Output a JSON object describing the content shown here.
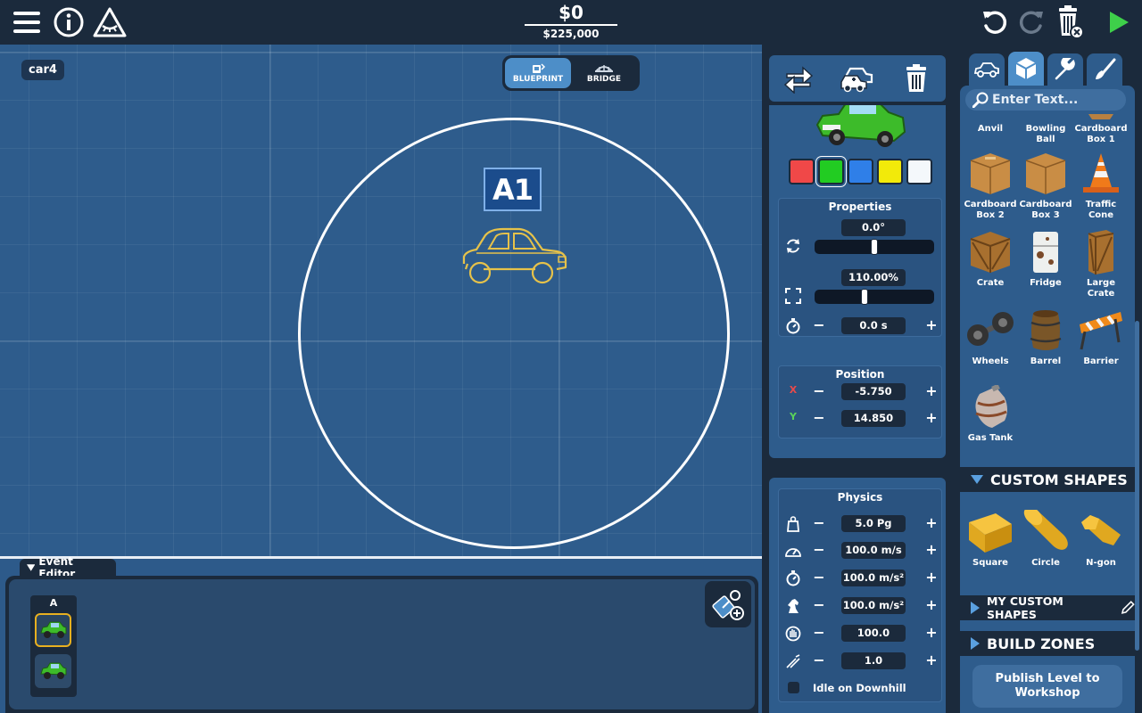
{
  "topbar": {
    "budget_current": "$0",
    "budget_max": "$225,000"
  },
  "canvas": {
    "object_name": "car4",
    "modes": [
      {
        "label": "BLUEPRINT",
        "active": true
      },
      {
        "label": "BRIDGE",
        "active": false
      }
    ],
    "trigger_label": "A1"
  },
  "event_editor": {
    "title": "Event Editor",
    "column_header": "A"
  },
  "properties": {
    "colors": [
      "#f04848",
      "#22cc22",
      "#2f7fe8",
      "#f2ea0a",
      "#f4f8fb"
    ],
    "selected_color": "#22cc22",
    "properties_title": "Properties",
    "rotation": "0.0°",
    "scale": "110.00%",
    "rotation_fraction": 0.5,
    "scale_fraction": 0.41,
    "delay": "0.0 s",
    "position_title": "Position",
    "x_label": "X",
    "y_label": "Y",
    "pos_x": "-5.750",
    "pos_y": "14.850",
    "physics_title": "Physics",
    "mass": "5.0 Pg",
    "max_speed": "100.0 m/s",
    "acceleration": "100.0 m/s²",
    "deceleration": "100.0 m/s²",
    "brake": "100.0",
    "spring": "1.0",
    "idle_label": "Idle on Downhill"
  },
  "catalog": {
    "search_placeholder": "Enter Text...",
    "items": [
      {
        "label": "Anvil"
      },
      {
        "label": "Bowling Ball"
      },
      {
        "label": "Cardboard Box 1"
      },
      {
        "label": "Cardboard Box 2"
      },
      {
        "label": "Cardboard Box 3"
      },
      {
        "label": "Traffic Cone"
      },
      {
        "label": "Crate"
      },
      {
        "label": "Fridge"
      },
      {
        "label": "Large Crate"
      },
      {
        "label": "Wheels"
      },
      {
        "label": "Barrel"
      },
      {
        "label": "Barrier"
      },
      {
        "label": "Gas Tank"
      }
    ],
    "custom_shapes_title": "CUSTOM SHAPES",
    "shapes": [
      {
        "label": "Square"
      },
      {
        "label": "Circle"
      },
      {
        "label": "N-gon"
      }
    ],
    "my_custom_shapes": "MY CUSTOM SHAPES",
    "build_zones": "BUILD ZONES",
    "publish_label": "Publish Level to Workshop"
  }
}
